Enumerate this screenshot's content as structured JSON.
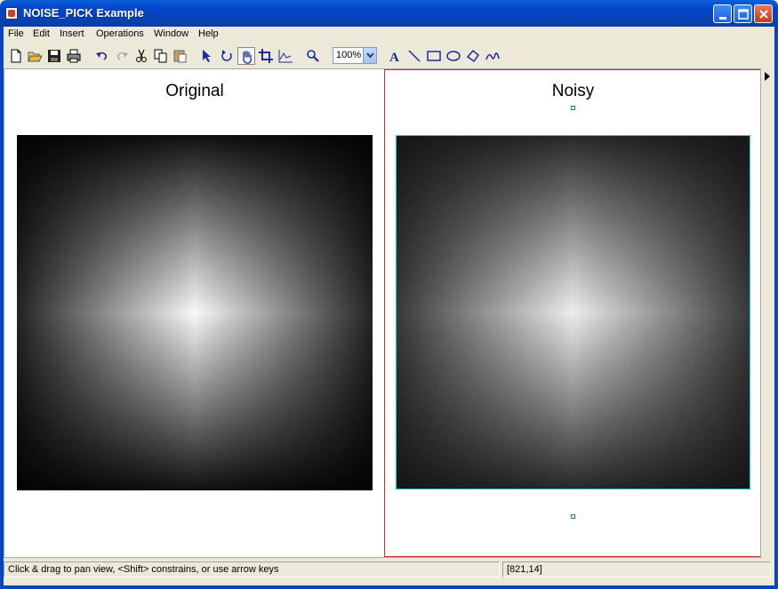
{
  "window": {
    "title": "NOISE_PICK Example",
    "controls": [
      "minimize-icon",
      "maximize-icon",
      "close-icon"
    ]
  },
  "menu": {
    "items": [
      {
        "label": "File"
      },
      {
        "label": "Edit"
      },
      {
        "label": "Insert"
      },
      {
        "label": "Operations"
      },
      {
        "label": "Window"
      },
      {
        "label": "Help"
      }
    ]
  },
  "toolbar": {
    "icons": [
      "new-icon",
      "open-icon",
      "save-icon",
      "print-icon",
      "undo-icon",
      "redo-icon",
      "cut-icon",
      "copy-icon",
      "paste-icon",
      "select-arrow-icon",
      "rotate-icon",
      "pan-hand-icon",
      "crop-icon",
      "plot-icon",
      "zoom-icon",
      "text-icon",
      "line-icon",
      "rectangle-icon",
      "ellipse-icon",
      "polygon-icon",
      "freehand-icon"
    ],
    "active_tool": "pan-hand-icon",
    "zoom": "100%"
  },
  "canvas": {
    "left_title": "Original",
    "right_title": "Noisy"
  },
  "status": {
    "message": "Click & drag to pan view, <Shift> constrains, or use arrow keys",
    "coords": "[821,14]"
  },
  "colors": {
    "titlebar": "#0346cc",
    "selection": "#d03030",
    "image_border": "#00e0e0",
    "handle": "#209020"
  }
}
